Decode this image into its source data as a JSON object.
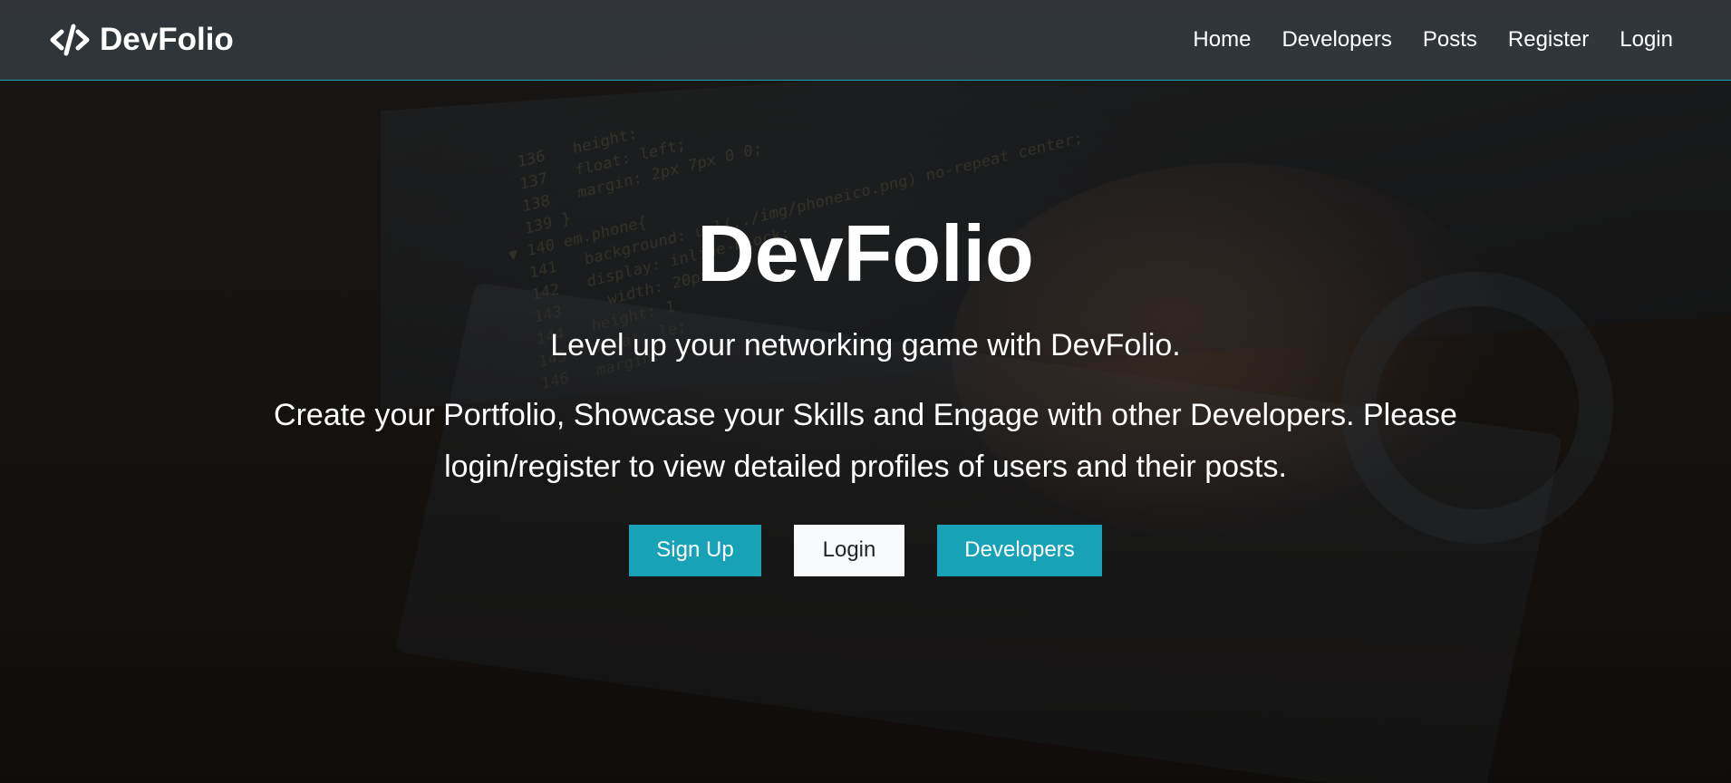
{
  "navbar": {
    "brand": "DevFolio",
    "brand_icon": "code-icon",
    "links": [
      "Home",
      "Developers",
      "Posts",
      "Register",
      "Login"
    ],
    "accent_border": "#17a2b8"
  },
  "hero": {
    "title": "DevFolio",
    "lead": "Level up your networking game with DevFolio.",
    "body": "Create your Portfolio, Showcase your Skills and Engage with other Developers. Please login/register to view detailed profiles of users and their posts.",
    "buttons": {
      "signup": "Sign Up",
      "login": "Login",
      "developers": "Developers"
    }
  },
  "colors": {
    "accent": "#17a2b8",
    "light_button": "#f8f9fa",
    "navbar_bg": "#343a40"
  }
}
